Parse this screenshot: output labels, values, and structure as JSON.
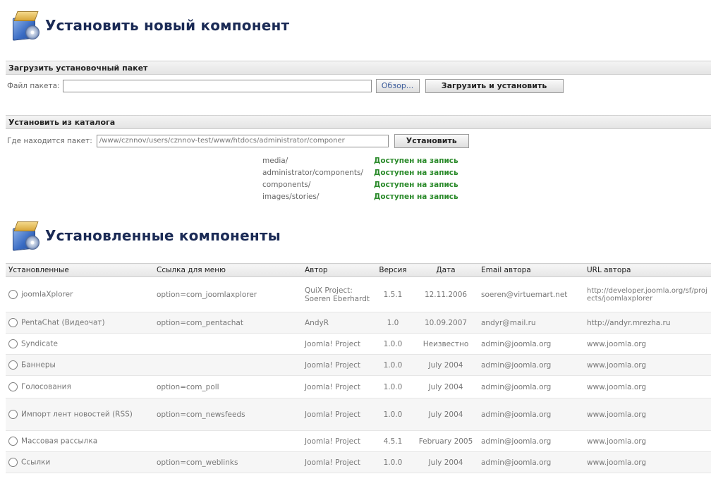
{
  "install_header": {
    "title": "Установить новый компонент"
  },
  "upload": {
    "section_label": "Загрузить установочный пакет",
    "file_label": "Файл пакета:",
    "file_value": "",
    "browse_label": "Обзор...",
    "upload_button_label": "Загрузить и установить"
  },
  "from_dir": {
    "section_label": "Установить из каталога",
    "path_label": "Где находится пакет:",
    "path_value": "/www/cznnov/users/cznnov-test/www/htdocs/administrator/componer",
    "install_button_label": "Установить",
    "permissions": [
      {
        "dir": "media/",
        "status": "Доступен на запись"
      },
      {
        "dir": "administrator/components/",
        "status": "Доступен на запись"
      },
      {
        "dir": "components/",
        "status": "Доступен на запись"
      },
      {
        "dir": "images/stories/",
        "status": "Доступен на запись"
      }
    ]
  },
  "installed_header": {
    "title": "Установленные компоненты"
  },
  "table": {
    "columns": [
      "Установленные",
      "Ссылка для меню",
      "Автор",
      "Версия",
      "Дата",
      "Email автора",
      "URL автора"
    ],
    "rows": [
      {
        "name": "joomlaXplorer",
        "menu_link": "option=com_joomlaxplorer",
        "author": "QuiX Project: Soeren Eberhardt",
        "version": "1.5.1",
        "date": "12.11.2006",
        "email": "soeren@virtuemart.net",
        "url": "http://developer.joomla.org/sf/projects/joomlaxplorer"
      },
      {
        "name": "PentaChat (Видеочат)",
        "menu_link": "option=com_pentachat",
        "author": "AndyR",
        "version": "1.0",
        "date": "10.09.2007",
        "email": "andyr@mail.ru",
        "url": "http://andyr.mrezha.ru"
      },
      {
        "name": "Syndicate",
        "menu_link": "",
        "author": "Joomla! Project",
        "version": "1.0.0",
        "date": "Неизвестно",
        "email": "admin@joomla.org",
        "url": "www.joomla.org"
      },
      {
        "name": "Баннеры",
        "menu_link": "",
        "author": "Joomla! Project",
        "version": "1.0.0",
        "date": "July 2004",
        "email": "admin@joomla.org",
        "url": "www.joomla.org"
      },
      {
        "name": "Голосования",
        "menu_link": "option=com_poll",
        "author": "Joomla! Project",
        "version": "1.0.0",
        "date": "July 2004",
        "email": "admin@joomla.org",
        "url": "www.joomla.org"
      },
      {
        "name": "Импорт лент новостей (RSS)",
        "menu_link": "option=com_newsfeeds",
        "author": "Joomla! Project",
        "version": "1.0.0",
        "date": "July 2004",
        "email": "admin@joomla.org",
        "url": "www.joomla.org"
      },
      {
        "name": "Массовая рассылка",
        "menu_link": "",
        "author": "Joomla! Project",
        "version": "4.5.1",
        "date": "February 2005",
        "email": "admin@joomla.org",
        "url": "www.joomla.org"
      },
      {
        "name": "Ссылки",
        "menu_link": "option=com_weblinks",
        "author": "Joomla! Project",
        "version": "1.0.0",
        "date": "July 2004",
        "email": "admin@joomla.org",
        "url": "www.joomla.org"
      }
    ]
  }
}
